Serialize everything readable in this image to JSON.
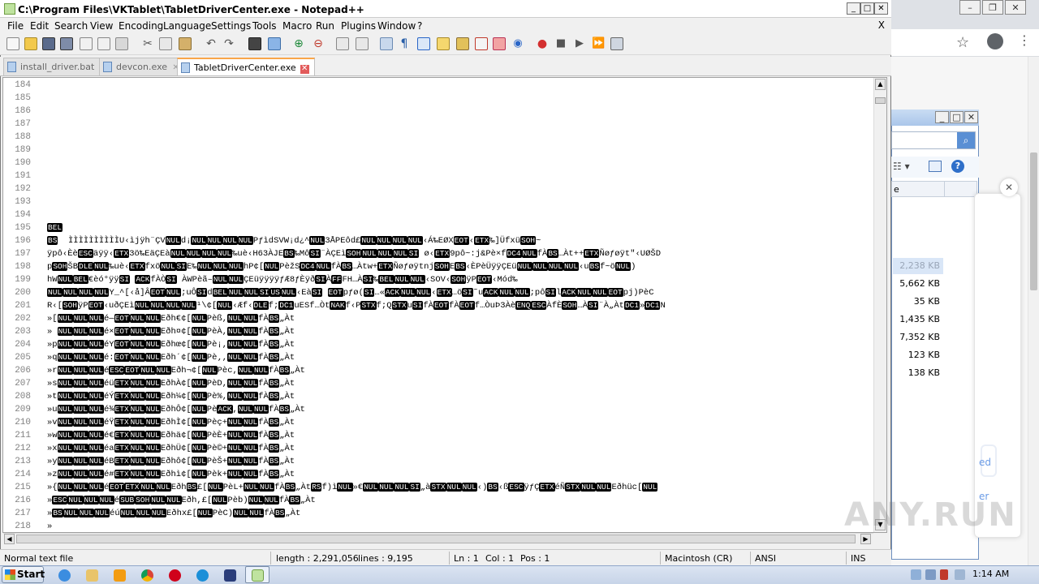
{
  "window": {
    "title": "C:\\Program Files\\VKTablet\\TabletDriverCenter.exe - Notepad++"
  },
  "menu": [
    "File",
    "Edit",
    "Search",
    "View",
    "Encoding",
    "Language",
    "Settings",
    "Tools",
    "Macro",
    "Run",
    "Plugins",
    "Window",
    "?"
  ],
  "menu_close": "X",
  "tabs": [
    {
      "label": "install_driver.bat",
      "active": false
    },
    {
      "label": "devcon.exe",
      "active": false
    },
    {
      "label": "TabletDriverCenter.exe",
      "active": true
    }
  ],
  "editor": {
    "lines": [
      {
        "n": "184",
        "text": ""
      },
      {
        "n": "185",
        "text": ""
      },
      {
        "n": "186",
        "text": ""
      },
      {
        "n": "187",
        "text": ""
      },
      {
        "n": "188",
        "text": ""
      },
      {
        "n": "189",
        "text": ""
      },
      {
        "n": "190",
        "text": ""
      },
      {
        "n": "191",
        "text": ""
      },
      {
        "n": "192",
        "text": ""
      },
      {
        "n": "193",
        "text": ""
      },
      {
        "n": "194",
        "text": ""
      },
      {
        "n": "195",
        "text": "BEL"
      },
      {
        "n": "196",
        "text": "BS  ÌÌÌÌÌÌÌÌÌÌU‹ìjÿh¨ÇVNULd¡NULNULNULNULPƒìdSVW¡d¿^NUL3ÅPEôd£NULNULNULNUL‹Á‰EØXEOT‹ETX‰]ÜfxüSOH~"
      },
      {
        "n": "197",
        "text": "ÿpô‹ÈèESCäÿÿ‹ETX3ö‰EäÇEàNULNULNULNUL‰uè‹H63ÀJEBS‰MôSI¨ÀÇEìSOHNULNULNULSI ø‹ETX9pô~:j&Pè×fDC4NULfÀBS…Àt++ETXÑøƒøÿt\"‹UØŠD"
      },
      {
        "n": "198",
        "text": "pSOHŠBDLENUL‰uè‹ETXfxöNULSIE‰NULNULNULhP¢[NULPèžSDC4NULfÀBS…Àtw+ETXÑøƒøÿtnjSOHEBS‹ÈPèÜÿÿÇEüNULNULNULNUL‹uBSf~öNUL)"
      },
      {
        "n": "199",
        "text": "hWNULBEL€èó°ÿÿSI ACKfÀÒSI ÀWPèã–NULNULÇEüÿÿÿÿƒÆ8ƒÈÿðSIÀFFFH…ÀSI‰BELNULNUL‹SOV‹SOHÿPEOT‹Mód‰"
      },
      {
        "n": "200",
        "text": "NULNULNULNULY_^[‹å]ÂEOTNUL;uÔSIdBELNULNULSIUSNUL‹EàSI EOTpƒø(SI…«ACKNULNUL‹ETX…öSI˜uACKNULNUL;pôSIlACKNULNULEOTpj)PèC"
      },
      {
        "n": "201",
        "text": "R‹[SOHÿPEOT‹uðÇEìNULNULNULNUL¹\\¢[NUL‹Æf‹DLEf;DC1uESf…ÒtNAKf‹PSTXf;QSTXuSIfÀEOTfÀEOTf…ÒuÞ3ÀèENQESCÀfÈSOH…ÀSI¨À„ÀtDC1»DC1N"
      },
      {
        "n": "202",
        "text": "»[NULNULNULé—EOTNULNULEðh€¢[NULPèß,NULNULfÀBS„Àt"
      },
      {
        "n": "203",
        "text": "» NULNULNULé×EOTNULNULEðh¤¢[NULPèÀ,NULNULfÀBS„Àt"
      },
      {
        "n": "204",
        "text": "»pNULNULNULéYEOTNULNULEðhœ¢[NULPè¡,NULNULfÀBS„Àt"
      },
      {
        "n": "205",
        "text": "»qNULNULNULé:EOTNULNULEðh´¢[NULPè‚,NULNULfÀBS„Àt"
      },
      {
        "n": "206",
        "text": "»rNULNULNULéESCEOTNULNULEðh¬¢[NULPèc,NULNULfÀBS„Àt"
      },
      {
        "n": "207",
        "text": "»sNULNULNULéüETXNULNULEðhÀ¢[NULPèD,NULNULfÀBS„Àt"
      },
      {
        "n": "208",
        "text": "»tNULNULNULéÝETXNULNULEðh¼¢[NULPè%,NULNULfÀBS„Àt"
      },
      {
        "n": "209",
        "text": "»uNULNULNULé¾ETXNULNULEðhÔ¢[NULPèACK,NULNULfÀBS„Àt"
      },
      {
        "n": "210",
        "text": "»vNULNULNULéŸETXNULNULEðhÌ¢[NULPèç+NULNULfÀBS„Àt"
      },
      {
        "n": "211",
        "text": "»wNULNULNULé€ETXNULNULEðhä¢[NULPèÈ+NULNULfÀBS„Àt"
      },
      {
        "n": "212",
        "text": "»xNULNULNULéaETXNULNULEðhÜ¢[NULPè©+NULNULfÀBS„Àt"
      },
      {
        "n": "213",
        "text": "»yNULNULNULéBETXNULNULEðhô¢[NULPèŠ+NULNULfÀBS„Àt"
      },
      {
        "n": "214",
        "text": "»zNULNULNULé#ETXNULNULEðhì¢[NULPèk+NULNULfÀBS„Àt"
      },
      {
        "n": "215",
        "text": "»{NULNULNULéEOTETXNULNULEðhBS£[NULPèL+NULNULfÀBS„ÀtRSf)ìNUL»€NULNULNULSI„àSTXNULNUL‹)BS‹ßESCÿƒÇETXéÑSTXNULNULEðhüc[NUL"
      },
      {
        "n": "216",
        "text": "»ESCNULNULNULéSUBSOHNULNULEðh,£[NULPèb)NULNULfÀBS„Àt"
      },
      {
        "n": "217",
        "text": "»BSNULNULNULéúNULNULNULEðhx£[NULPèC)NULNULfÀBS„Àt"
      },
      {
        "n": "218",
        "text": "»"
      }
    ]
  },
  "status": {
    "file_type": "Normal text file",
    "length": "length : 2,291,056",
    "lines": "lines : 9,195",
    "ln": "Ln : 1",
    "col": "Col : 1",
    "pos": "Pos : 1",
    "eol": "Macintosh (CR)",
    "encoding": "ANSI",
    "mode": "INS"
  },
  "explorer": {
    "header": "e",
    "sizes": [
      "2,238 KB",
      "5,662 KB",
      "35 KB",
      "1,435 KB",
      "7,352 KB",
      "123 KB",
      "138 KB"
    ]
  },
  "popup": {
    "link1": "ed",
    "link2": "er"
  },
  "taskbar": {
    "start": "Start",
    "time": "1:14 AM"
  },
  "watermark": "ANY.RUN",
  "colors": {
    "tab_accent": "#f9a64a",
    "control_token_bg": "#000000",
    "control_token_fg": "#ffffff"
  }
}
